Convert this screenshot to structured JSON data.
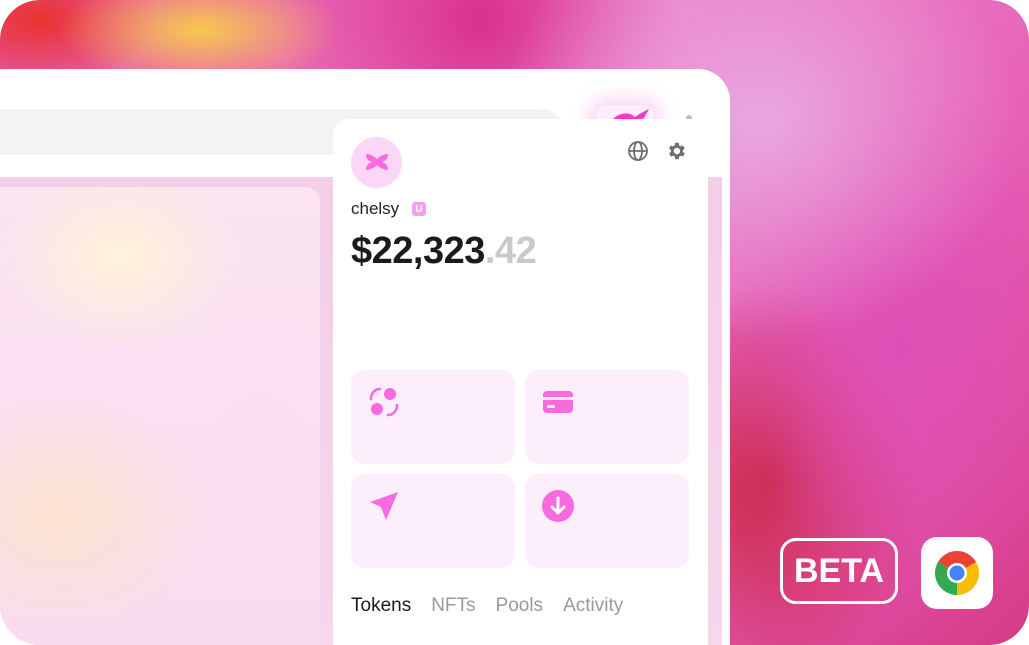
{
  "wallet": {
    "username": "chelsy",
    "unitag_letter": "U",
    "balance_whole": "$22,323",
    "balance_cents": ".42",
    "tabs": [
      {
        "label": "Tokens"
      },
      {
        "label": "NFTs"
      },
      {
        "label": "Pools"
      },
      {
        "label": "Activity"
      }
    ],
    "actions": [
      "swap-icon",
      "card-icon",
      "send-icon",
      "receive-icon"
    ]
  },
  "badge": {
    "label": "BETA"
  },
  "colors": {
    "accent": "#f76ae0",
    "accent_bg": "#fdeefb",
    "brand": "#ff37c7"
  }
}
